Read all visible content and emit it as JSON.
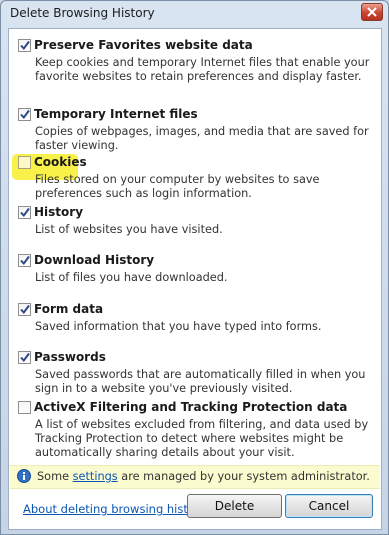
{
  "window": {
    "title": "Delete Browsing History"
  },
  "items": [
    {
      "label": "Preserve Favorites website data",
      "checked": true,
      "description": "Keep cookies and temporary Internet files that enable your favorite websites to retain preferences and display faster."
    },
    {
      "label": "Temporary Internet files",
      "checked": true,
      "description": "Copies of webpages, images, and media that are saved for faster viewing."
    },
    {
      "label": "Cookies",
      "checked": false,
      "description": "Files stored on your computer by websites to save preferences such as login information."
    },
    {
      "label": "History",
      "checked": true,
      "description": "List of websites you have visited."
    },
    {
      "label": "Download History",
      "checked": true,
      "description": "List of files you have downloaded."
    },
    {
      "label": "Form data",
      "checked": true,
      "description": "Saved information that you have typed into forms."
    },
    {
      "label": "Passwords",
      "checked": true,
      "description": "Saved passwords that are automatically filled in when you sign in to a website you've previously visited."
    },
    {
      "label": "ActiveX Filtering and Tracking Protection data",
      "checked": false,
      "description": "A list of websites excluded from filtering, and data used by Tracking Protection to detect where websites might be automatically sharing details about your visit."
    }
  ],
  "info": {
    "text_before": "Some ",
    "link": "settings",
    "text_after": " are managed by your system administrator."
  },
  "footer": {
    "about_link": "About deleting browsing history",
    "delete_label": "Delete",
    "cancel_label": "Cancel"
  },
  "colors": {
    "highlight": "#f6f03a",
    "link": "#0a56b4",
    "info_bar": "#fbfbd0"
  },
  "icons": {
    "close": "close-icon",
    "info": "info-icon",
    "check": "checkmark-icon"
  }
}
